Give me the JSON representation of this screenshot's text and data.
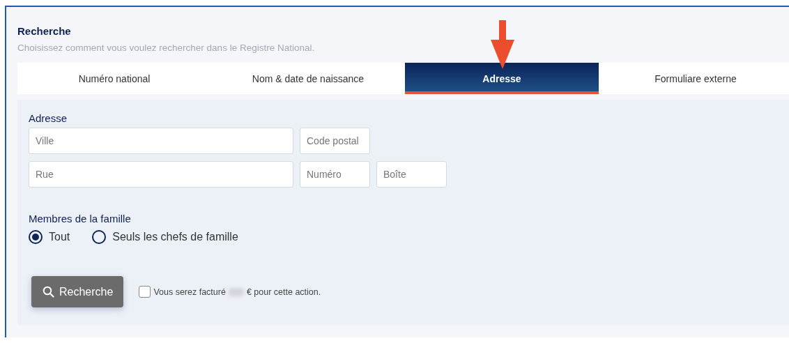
{
  "header": {
    "title": "Recherche",
    "subtitle": "Choisissez comment vous voulez rechercher dans le Registre National."
  },
  "tabs": [
    {
      "label": "Numéro national",
      "selected": false
    },
    {
      "label": "Nom & date de naissance",
      "selected": false
    },
    {
      "label": "Adresse",
      "selected": true
    },
    {
      "label": "Formuliare externe",
      "selected": false
    }
  ],
  "address": {
    "label": "Adresse",
    "rows": [
      [
        {
          "placeholder": "Ville",
          "kind": "wide"
        },
        {
          "placeholder": "Code postal",
          "kind": "short"
        }
      ],
      [
        {
          "placeholder": "Rue",
          "kind": "wide"
        },
        {
          "placeholder": "Numéro",
          "kind": "short"
        },
        {
          "placeholder": "Boîte",
          "kind": "short"
        }
      ]
    ]
  },
  "family_members": {
    "label": "Membres de la famille",
    "options": [
      {
        "label": "Tout",
        "selected": true
      },
      {
        "label": "Seuls les chefs de famille",
        "selected": false
      }
    ]
  },
  "search_button": {
    "label": "Recherche"
  },
  "billing_notice": {
    "checked": false,
    "text_before": "Vous serez facturé",
    "text_after": "€ pour cette action."
  }
}
